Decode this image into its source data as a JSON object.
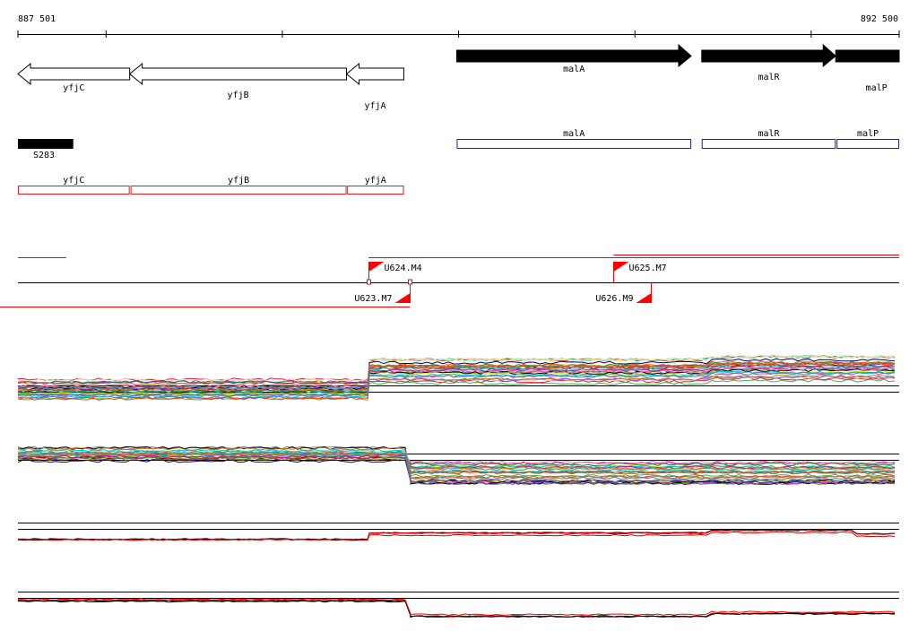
{
  "ruler": {
    "start_label": "887 501",
    "end_label": "892 500",
    "start": 887501,
    "end": 892500
  },
  "genes_top": [
    {
      "name": "yfjC",
      "strand": "-",
      "style": "open",
      "start": 887501,
      "end": 888135
    },
    {
      "name": "yfjB",
      "strand": "-",
      "style": "open",
      "start": 888135,
      "end": 889365
    },
    {
      "name": "yfjA",
      "strand": "-",
      "style": "open",
      "start": 889365,
      "end": 889690
    },
    {
      "name": "malA",
      "strand": "+",
      "style": "filled",
      "start": 889990,
      "end": 891320
    },
    {
      "name": "malR",
      "strand": "+",
      "style": "filled",
      "start": 891380,
      "end": 892140
    },
    {
      "name": "malP",
      "strand": "+",
      "style": "filled",
      "start": 892140,
      "end": 892500
    }
  ],
  "feature_track": {
    "name": "S283",
    "start": 887501,
    "end": 887815
  },
  "transcripts_blue": [
    {
      "name": "malA",
      "start": 889990,
      "end": 891320
    },
    {
      "name": "malR",
      "start": 891380,
      "end": 892140
    },
    {
      "name": "malP",
      "start": 892145,
      "end": 892500
    }
  ],
  "transcripts_red": [
    {
      "name": "yfjC",
      "start": 887501,
      "end": 888135
    },
    {
      "name": "yfjB",
      "start": 888140,
      "end": 889365
    },
    {
      "name": "yfjA",
      "start": 889368,
      "end": 889690
    }
  ],
  "segments": {
    "upper": [
      {
        "start": 887501,
        "end": 887775
      },
      {
        "start": 889490,
        "end": 892500
      },
      {
        "start": 890880,
        "end": 892500
      }
    ],
    "lower": [
      {
        "start": 887400,
        "end": 889725
      }
    ]
  },
  "flags": [
    {
      "label": "U624.M4",
      "position": 889490,
      "strand": "+"
    },
    {
      "label": "U625.M7",
      "position": 890880,
      "strand": "+"
    },
    {
      "label": "U623.M7",
      "position": 889725,
      "strand": "-"
    },
    {
      "label": "U626.M9",
      "position": 891090,
      "strand": "-"
    }
  ],
  "colors": {
    "feature": "#000000",
    "transcript_plus": "#1f1fb0",
    "transcript_minus": "#e02020",
    "flag": "#ff0000"
  },
  "expression_panels": [
    {
      "kind": "multi",
      "step_at": 889490,
      "before": 0.55,
      "after": 0.2
    },
    {
      "kind": "multi",
      "step_at": 889725,
      "before": 0.35,
      "after": 0.75
    },
    {
      "kind": "pair",
      "step_at": 889490,
      "before": 0.65,
      "after": 0.45
    },
    {
      "kind": "pair",
      "step_at": 889725,
      "before": 0.35,
      "after": 0.85
    }
  ]
}
